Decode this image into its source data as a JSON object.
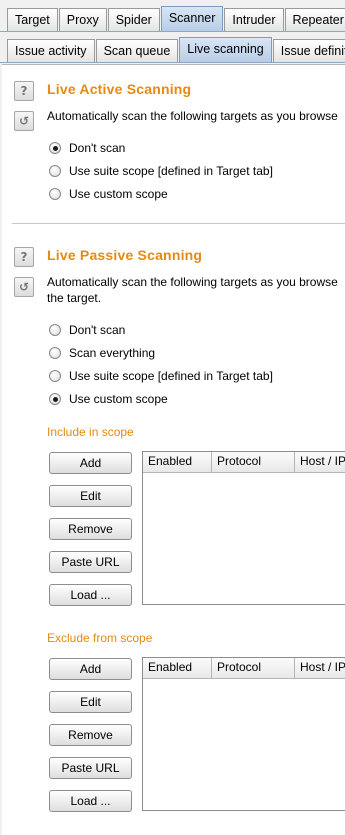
{
  "tabs_main": [
    "Target",
    "Proxy",
    "Spider",
    "Scanner",
    "Intruder",
    "Repeater"
  ],
  "tabs_scanner": [
    "Issue activity",
    "Scan queue",
    "Live scanning",
    "Issue definit"
  ],
  "icons": {
    "help": "?",
    "defaults": "↺"
  },
  "active": {
    "title": "Live Active Scanning",
    "description": "Automatically scan the following targets as you browse",
    "options": [
      "Don't scan",
      "Use suite scope [defined in Target tab]",
      "Use custom scope"
    ],
    "selected": 0
  },
  "passive": {
    "title": "Live Passive Scanning",
    "description": "Automatically scan the following targets as you browse the target.",
    "options": [
      "Don't scan",
      "Scan everything",
      "Use suite scope [defined in Target tab]",
      "Use custom scope"
    ],
    "selected": 3,
    "include_title": "Include in scope",
    "exclude_title": "Exclude from scope",
    "buttons": [
      "Add",
      "Edit",
      "Remove",
      "Paste URL",
      "Load ..."
    ],
    "columns": [
      "Enabled",
      "Protocol",
      "Host / IP"
    ]
  }
}
